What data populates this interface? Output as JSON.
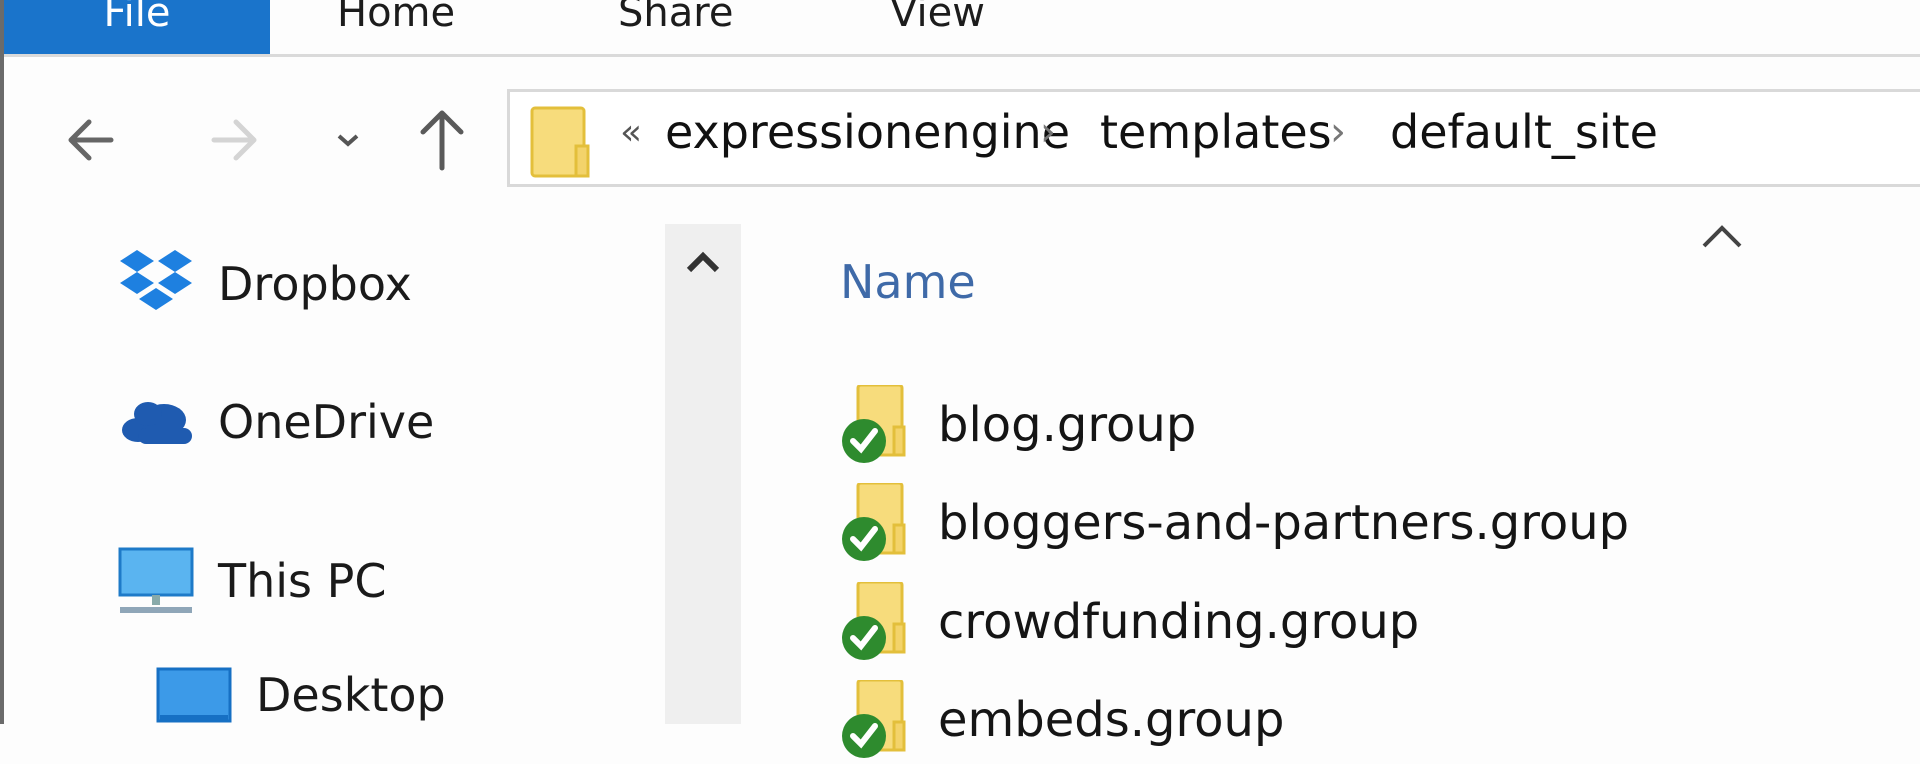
{
  "ribbon": {
    "tabs": [
      {
        "label": "File",
        "active": true
      },
      {
        "label": "Home",
        "active": false
      },
      {
        "label": "Share",
        "active": false
      },
      {
        "label": "View",
        "active": false
      }
    ],
    "accent": "#1a74cb"
  },
  "navigation": {
    "back_icon": "arrow-left-icon",
    "forward_icon": "arrow-right-icon",
    "recent_icon": "chevron-down-icon",
    "up_icon": "arrow-up-icon"
  },
  "address_bar": {
    "overflow": "«",
    "breadcrumbs": [
      "expressionengine",
      "templates",
      "default_site"
    ],
    "separator": "›"
  },
  "nav_pane": {
    "items": [
      {
        "label": "Dropbox",
        "icon": "dropbox-icon"
      },
      {
        "label": "OneDrive",
        "icon": "onedrive-cloud-icon"
      },
      {
        "label": "This PC",
        "icon": "monitor-icon"
      },
      {
        "label": "Desktop",
        "icon": "desktop-icon"
      }
    ]
  },
  "file_list": {
    "column_header": "Name",
    "sort": "ascending",
    "files": [
      {
        "name": "blog.group",
        "sync_status": "synced"
      },
      {
        "name": "bloggers-and-partners.group",
        "sync_status": "synced"
      },
      {
        "name": "crowdfunding.group",
        "sync_status": "synced"
      },
      {
        "name": "embeds.group",
        "sync_status": "synced"
      }
    ]
  },
  "colors": {
    "folder": "#f5d874",
    "sync_ok": "#2e8b2e",
    "header_text": "#3f6aa8"
  }
}
